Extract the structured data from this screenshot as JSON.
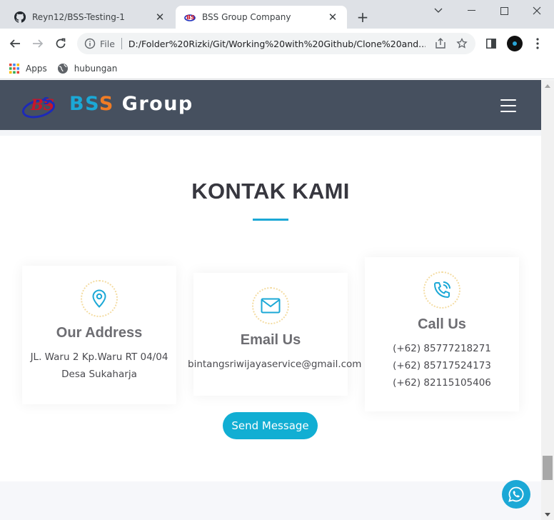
{
  "browser": {
    "tabs": [
      {
        "title": "Reyn12/BSS-Testing-1",
        "icon": "github-icon",
        "active": false
      },
      {
        "title": "BSS Group Company",
        "icon": "bss-favicon",
        "active": true
      }
    ],
    "address_scheme": "File",
    "url": "D:/Folder%20Rizki/Git/Working%20with%20Github/Clone%20and...",
    "bookmarks": [
      {
        "label": "Apps",
        "icon": "apps-grid-icon"
      },
      {
        "label": "hubungan",
        "icon": "globe-icon"
      }
    ]
  },
  "site": {
    "brand": {
      "letter1": "B",
      "letter2": "S",
      "letter3": "S",
      "rest": " Group"
    },
    "colors": {
      "header_bg": "#46505f",
      "accent": "#1ba8d6",
      "brand_orange": "#f07c25"
    },
    "section_title": "KONTAK KAMI",
    "cards": [
      {
        "icon": "map-pin-icon",
        "title": "Our Address",
        "lines": [
          "JL. Waru 2 Kp.Waru RT 04/04",
          "Desa Sukaharja"
        ]
      },
      {
        "icon": "envelope-icon",
        "title": "Email Us",
        "lines": [
          "bintangsriwijayaservice@gmail.com"
        ]
      },
      {
        "icon": "phone-icon",
        "title": "Call Us",
        "lines": [
          "(+62) 85777218271",
          "(+62) 85717524173",
          "(+62) 82115105406"
        ]
      }
    ],
    "send_button": "Send Message",
    "float_icon": "whatsapp-icon"
  }
}
